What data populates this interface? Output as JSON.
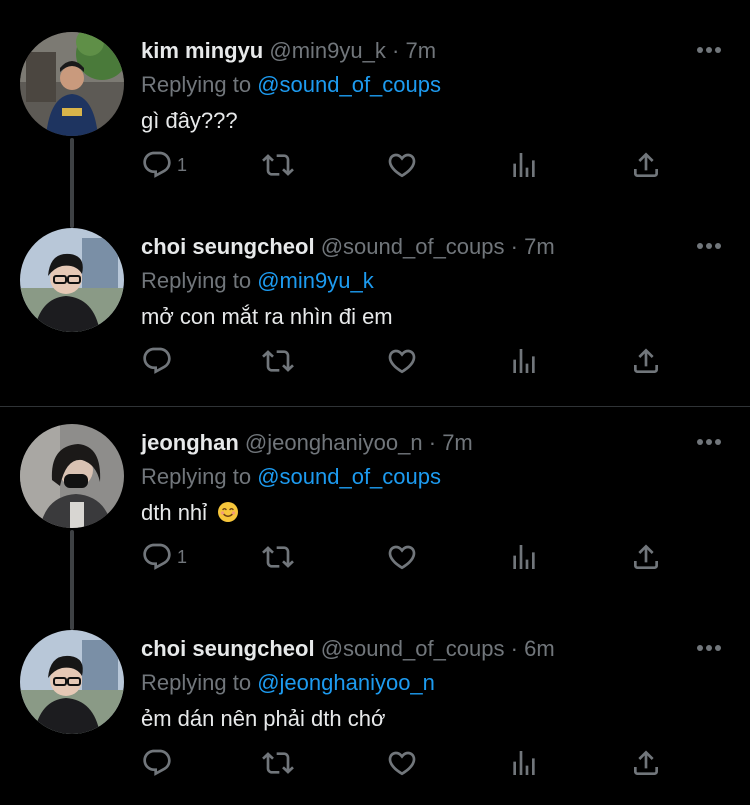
{
  "tweets": [
    {
      "name": "kim mingyu",
      "handle": "@min9yu_k",
      "dot": "·",
      "time": "7m",
      "replying_prefix": "Replying to",
      "replying_to": "@sound_of_coups",
      "text": "gì đây???",
      "reply_count": "1",
      "avatar_colors": {
        "bg": "#6e6a62",
        "accent": "#4a7a3a",
        "shirt": "#1e3460"
      }
    },
    {
      "name": "choi seungcheol",
      "handle": "@sound_of_coups",
      "dot": "·",
      "time": "7m",
      "replying_prefix": "Replying to",
      "replying_to": "@min9yu_k",
      "text": "mở con mắt ra nhìn đi em",
      "reply_count": "",
      "avatar_colors": {
        "bg": "#b8c7d8",
        "accent": "#7a8fa6",
        "shirt": "#1c1c1f"
      }
    },
    {
      "name": "jeonghan",
      "handle": "@jeonghaniyoo_n",
      "dot": "·",
      "time": "7m",
      "replying_prefix": "Replying to",
      "replying_to": "@sound_of_coups",
      "text": "dth nhỉ",
      "reply_count": "1",
      "avatar_colors": {
        "bg": "#8e8d8b",
        "accent": "#d8d6d2",
        "shirt": "#3a3a3c"
      }
    },
    {
      "name": "choi seungcheol",
      "handle": "@sound_of_coups",
      "dot": "·",
      "time": "6m",
      "replying_prefix": "Replying to",
      "replying_to": "@jeonghaniyoo_n",
      "text": "ẻm dán nên phải dth chớ",
      "reply_count": "",
      "avatar_colors": {
        "bg": "#b8c7d8",
        "accent": "#7a8fa6",
        "shirt": "#1c1c1f"
      }
    }
  ],
  "icons": {
    "reply": "reply-icon",
    "retweet": "retweet-icon",
    "like": "heart-icon",
    "views": "views-icon",
    "share": "share-icon",
    "more": "more-icon"
  },
  "theme": {
    "background": "#000000",
    "text": "#e7e9ea",
    "muted": "#71767b",
    "link": "#1d9bf0",
    "divider": "#2f3336"
  }
}
